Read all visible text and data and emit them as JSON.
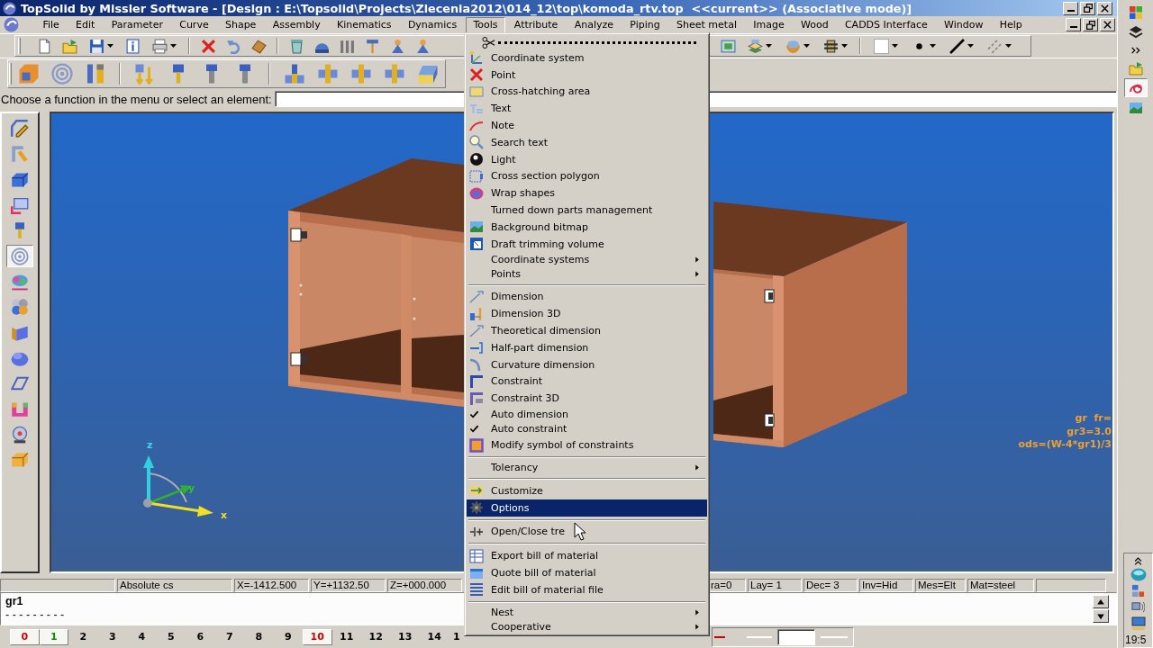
{
  "window": {
    "title": "TopSolid by Missler Software - [Design : E:\\Topsolid\\Projects\\Zlecenia2012\\014_12\\top\\komoda_rtv.top  <<current>> (Associative mode)]"
  },
  "menu_bar": [
    {
      "label": "File",
      "selected": false
    },
    {
      "label": "Edit",
      "selected": false
    },
    {
      "label": "Parameter",
      "selected": false
    },
    {
      "label": "Curve",
      "selected": false
    },
    {
      "label": "Shape",
      "selected": false
    },
    {
      "label": "Assembly",
      "selected": false
    },
    {
      "label": "Kinematics",
      "selected": false
    },
    {
      "label": "Dynamics",
      "selected": false
    },
    {
      "label": "Tools",
      "selected": true
    },
    {
      "label": "Attribute",
      "selected": false
    },
    {
      "label": "Analyze",
      "selected": false
    },
    {
      "label": "Piping",
      "selected": false
    },
    {
      "label": "Sheet metal",
      "selected": false
    },
    {
      "label": "Image",
      "selected": false
    },
    {
      "label": "Wood",
      "selected": false
    },
    {
      "label": "CADDS Interface",
      "selected": false
    },
    {
      "label": "Window",
      "selected": false
    },
    {
      "label": "Help",
      "selected": false
    }
  ],
  "prompt": {
    "label": "Choose a function in the menu or select an element:"
  },
  "tool_palette": [
    {
      "selected": false
    },
    {
      "selected": false
    },
    {
      "selected": false
    },
    {
      "selected": false
    },
    {
      "selected": false
    },
    {
      "selected": true
    },
    {
      "selected": false
    },
    {
      "selected": false
    },
    {
      "selected": false
    },
    {
      "selected": false
    },
    {
      "selected": false
    },
    {
      "selected": false
    },
    {
      "selected": false
    },
    {
      "selected": false
    }
  ],
  "side_bar": [
    {
      "selected": false
    },
    {
      "selected": false
    },
    {
      "selected": false
    },
    {
      "selected": true
    },
    {
      "selected": false
    }
  ],
  "viewport": {
    "annotations": [
      "gr  fr=",
      "gr3=3.0",
      "ods=(W-4*gr1)/3"
    ],
    "axis_labels": [
      "z",
      "y",
      "x"
    ]
  },
  "status_bar": {
    "left_fields": [
      "Absolute cs",
      "X=-1412.500",
      "Y=+1132.50",
      "Z=+000.000"
    ],
    "right_fields": [
      "ra=0",
      "Lay= 1",
      "Dec= 3",
      "Inv=Hid",
      "Mes=Elt",
      "Mat=steel"
    ]
  },
  "command_area": {
    "text": "gr1",
    "rule": "- - - - - - - - -"
  },
  "layers": [
    {
      "label": "0",
      "color": "#d40000",
      "used": true
    },
    {
      "label": "1",
      "color": "#009a00",
      "used": true
    },
    {
      "label": "2",
      "color": "#000000",
      "used": false
    },
    {
      "label": "3",
      "color": "#000000",
      "used": false
    },
    {
      "label": "4",
      "color": "#000000",
      "used": false
    },
    {
      "label": "5",
      "color": "#000000",
      "used": false
    },
    {
      "label": "6",
      "color": "#000000",
      "used": false
    },
    {
      "label": "7",
      "color": "#000000",
      "used": false
    },
    {
      "label": "8",
      "color": "#000000",
      "used": false
    },
    {
      "label": "9",
      "color": "#000000",
      "used": false
    },
    {
      "label": "10",
      "color": "#d40000",
      "used": true
    },
    {
      "label": "11",
      "color": "#000000",
      "used": false
    },
    {
      "label": "12",
      "color": "#000000",
      "used": false
    },
    {
      "label": "13",
      "color": "#000000",
      "used": false
    },
    {
      "label": "14",
      "color": "#000000",
      "used": false
    },
    {
      "label": "1",
      "color": "#000000",
      "used": false
    }
  ],
  "clock": "19:5",
  "tools_menu": {
    "sections": [
      [
        {
          "kind": "tearoff"
        },
        {
          "kind": "command",
          "label": "Coordinate system",
          "checked": false,
          "selected": false
        },
        {
          "kind": "command",
          "label": "Point",
          "checked": false,
          "selected": false
        },
        {
          "kind": "command",
          "label": "Cross-hatching area",
          "checked": false,
          "selected": false
        },
        {
          "kind": "command",
          "label": "Text",
          "checked": false,
          "selected": false
        },
        {
          "kind": "command",
          "label": "Note",
          "checked": false,
          "selected": false
        },
        {
          "kind": "command",
          "label": "Search text",
          "checked": false,
          "selected": false
        },
        {
          "kind": "command",
          "label": "Light",
          "checked": false,
          "selected": false
        },
        {
          "kind": "command",
          "label": "Cross section polygon",
          "checked": false,
          "selected": false
        },
        {
          "kind": "command",
          "label": "Wrap shapes",
          "checked": false,
          "selected": false
        },
        {
          "kind": "command",
          "label": "Turned down parts management",
          "checked": false,
          "selected": false
        },
        {
          "kind": "command",
          "label": "Background bitmap",
          "checked": false,
          "selected": false
        },
        {
          "kind": "command",
          "label": "Draft trimming volume",
          "checked": false,
          "selected": false
        },
        {
          "kind": "submenu",
          "label": "Coordinate systems",
          "checked": false,
          "selected": false
        },
        {
          "kind": "submenu",
          "label": "Points",
          "checked": false,
          "selected": false
        }
      ],
      [
        {
          "kind": "command",
          "label": "Dimension",
          "checked": false,
          "selected": false
        },
        {
          "kind": "command",
          "label": "Dimension 3D",
          "checked": false,
          "selected": false
        },
        {
          "kind": "command",
          "label": "Theoretical dimension",
          "checked": false,
          "selected": false
        },
        {
          "kind": "command",
          "label": "Half-part dimension",
          "checked": false,
          "selected": false
        },
        {
          "kind": "command",
          "label": "Curvature dimension",
          "checked": false,
          "selected": false
        },
        {
          "kind": "command",
          "label": "Constraint",
          "checked": false,
          "selected": false
        },
        {
          "kind": "command",
          "label": "Constraint 3D",
          "checked": false,
          "selected": false
        },
        {
          "kind": "command",
          "label": "Auto dimension",
          "checked": true,
          "selected": false
        },
        {
          "kind": "command",
          "label": "Auto constraint",
          "checked": true,
          "selected": false
        },
        {
          "kind": "command",
          "label": "Modify symbol of constraints",
          "checked": false,
          "selected": false
        }
      ],
      [
        {
          "kind": "submenu",
          "label": "Tolerancy",
          "checked": false,
          "selected": false
        }
      ],
      [
        {
          "kind": "command",
          "label": "Customize",
          "checked": false,
          "selected": false
        },
        {
          "kind": "command",
          "label": "Options",
          "checked": false,
          "selected": true
        }
      ],
      [
        {
          "kind": "command",
          "label": "Open/Close tre",
          "checked": false,
          "selected": false
        }
      ],
      [
        {
          "kind": "command",
          "label": "Export bill of material",
          "checked": false,
          "selected": false
        },
        {
          "kind": "command",
          "label": "Quote bill of material",
          "checked": false,
          "selected": false
        },
        {
          "kind": "command",
          "label": "Edit bill of material file",
          "checked": false,
          "selected": false
        }
      ],
      [
        {
          "kind": "submenu",
          "label": "Nest",
          "checked": false,
          "selected": false
        },
        {
          "kind": "submenu",
          "label": "Cooperative",
          "checked": false,
          "selected": false
        }
      ]
    ]
  }
}
